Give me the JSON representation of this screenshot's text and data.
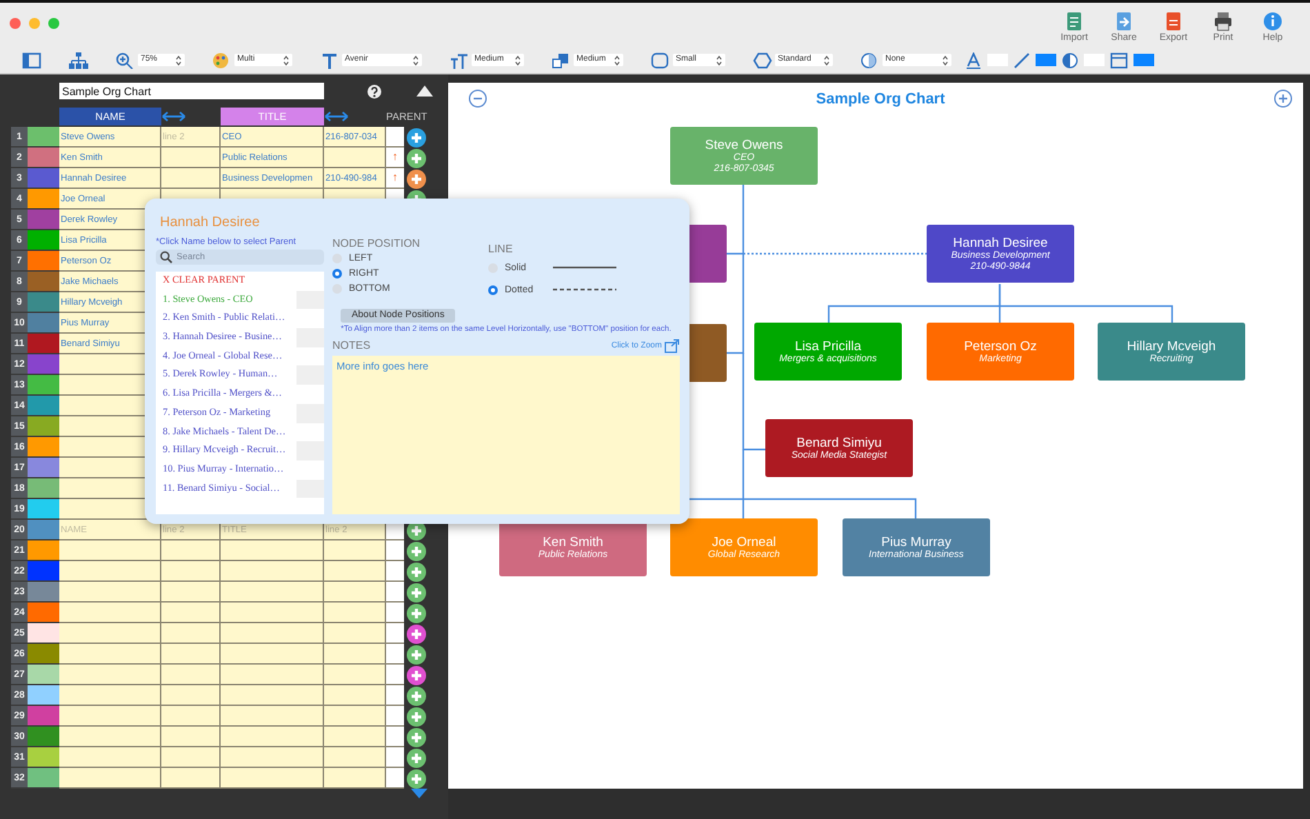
{
  "toolbar": {
    "actions": [
      {
        "label": "Import",
        "kind": "import"
      },
      {
        "label": "Share",
        "kind": "share"
      },
      {
        "label": "Export",
        "kind": "export"
      },
      {
        "label": "Print",
        "kind": "print"
      },
      {
        "label": "Help",
        "kind": "help"
      }
    ]
  },
  "format_bar": [
    {
      "kind": "zoom",
      "value": "75%"
    },
    {
      "kind": "palette",
      "value": "Multi"
    },
    {
      "kind": "font",
      "value": "Avenir"
    },
    {
      "kind": "text-size",
      "value": "Medium"
    },
    {
      "kind": "shadow",
      "value": "Medium"
    },
    {
      "kind": "corner",
      "value": "Small"
    },
    {
      "kind": "shape",
      "value": "Standard"
    },
    {
      "kind": "opacity",
      "value": "None"
    }
  ],
  "sheet": {
    "chart_name": "Sample Org Chart",
    "columns": [
      {
        "kind": "name",
        "label": "NAME"
      },
      {
        "kind": "resize"
      },
      {
        "kind": "title",
        "label": "TITLE"
      },
      {
        "kind": "resize"
      },
      {
        "kind": "parent",
        "label": "PARENT"
      }
    ],
    "rows": [
      {
        "number": "1",
        "color": "#6cbf6c",
        "name": "Steve Owens",
        "line2_placeholder": "line 2",
        "title": "CEO",
        "title_line2": "216-807-034",
        "add_button": {
          "color": "#2aa0e0"
        }
      },
      {
        "number": "2",
        "color": "#d07080",
        "name": "Ken Smith",
        "title": "Public Relations",
        "parent_mark": "↑",
        "add_button": {
          "color": "#6cc070"
        }
      },
      {
        "number": "3",
        "color": "#5a5ad0",
        "name": "Hannah Desiree",
        "title": "Business Developmen",
        "title_line2": "210-490-984",
        "parent_mark": "↑",
        "add_button": {
          "color": "#f0904c"
        }
      },
      {
        "number": "4",
        "color": "#ff9900",
        "name": "Joe Orneal",
        "add_button": {
          "color": "#6cc070"
        }
      },
      {
        "number": "5",
        "color": "#a040a0",
        "name": "Derek Rowley"
      },
      {
        "number": "6",
        "color": "#00b000",
        "name": "Lisa Pricilla"
      },
      {
        "number": "7",
        "color": "#ff7000",
        "name": "Peterson Oz"
      },
      {
        "number": "8",
        "color": "#9a6024",
        "name": "Jake Michaels"
      },
      {
        "number": "9",
        "color": "#3a8a8a",
        "name": "Hillary Mcveigh"
      },
      {
        "number": "10",
        "color": "#5080a0",
        "name": "Pius Murray"
      },
      {
        "number": "11",
        "color": "#b01820",
        "name": "Benard Simiyu"
      },
      {
        "number": "12",
        "color": "#8844cc"
      },
      {
        "number": "13",
        "color": "#44bb44"
      },
      {
        "number": "14",
        "color": "#2299aa"
      },
      {
        "number": "15",
        "color": "#88aa22"
      },
      {
        "number": "16",
        "color": "#ff9900"
      },
      {
        "number": "17",
        "color": "#8888dd"
      },
      {
        "number": "18",
        "color": "#77bb77"
      },
      {
        "number": "19",
        "color": "#22ccee"
      },
      {
        "number": "20",
        "color": "#5090c0",
        "name_placeholder": "NAME",
        "line2_placeholder": "line 2",
        "title_placeholder": "TITLE",
        "title_line2_placeholder": "line 2",
        "add_button": {
          "color": "#6cc070"
        }
      },
      {
        "number": "21",
        "color": "#ff9900",
        "add_button": {
          "color": "#6cc070"
        }
      },
      {
        "number": "22",
        "color": "#0033ff",
        "add_button": {
          "color": "#6cc070"
        }
      },
      {
        "number": "23",
        "color": "#778899",
        "add_button": {
          "color": "#6cc070"
        }
      },
      {
        "number": "24",
        "color": "#ff6a00",
        "add_button": {
          "color": "#6cc070"
        }
      },
      {
        "number": "25",
        "color": "#ffe4e4",
        "add_button": {
          "color": "#e050d0"
        }
      },
      {
        "number": "26",
        "color": "#8a8a00",
        "add_button": {
          "color": "#6cc070"
        }
      },
      {
        "number": "27",
        "color": "#a8d8a8",
        "add_button": {
          "color": "#e050d0"
        }
      },
      {
        "number": "28",
        "color": "#90d0ff",
        "add_button": {
          "color": "#6cc070"
        }
      },
      {
        "number": "29",
        "color": "#d040a0",
        "add_button": {
          "color": "#6cc070"
        }
      },
      {
        "number": "30",
        "color": "#309020",
        "add_button": {
          "color": "#6cc070"
        }
      },
      {
        "number": "31",
        "color": "#a8d040",
        "add_button": {
          "color": "#6cc070"
        }
      },
      {
        "number": "32",
        "color": "#70c080",
        "add_button": {
          "color": "#6cc070"
        }
      }
    ]
  },
  "node_editor": {
    "title": "Hannah Desiree",
    "parent_hint": "*Click Name below to select Parent",
    "search_placeholder": "Search",
    "parents": [
      {
        "label": "X CLEAR PARENT",
        "kind": "clear",
        "selected": false
      },
      {
        "label": "1. Steve Owens - CEO",
        "kind": "person",
        "selected": true
      },
      {
        "label": "2. Ken Smith - Public Relati…",
        "kind": "person",
        "selected": false
      },
      {
        "label": "3. Hannah Desiree - Busine…",
        "kind": "person",
        "selected": false
      },
      {
        "label": "4. Joe Orneal - Global Rese…",
        "kind": "person",
        "selected": false
      },
      {
        "label": "5. Derek Rowley - Human…",
        "kind": "person",
        "selected": false
      },
      {
        "label": "6. Lisa Pricilla - Mergers &…",
        "kind": "person",
        "selected": false
      },
      {
        "label": "7. Peterson Oz - Marketing",
        "kind": "person",
        "selected": false
      },
      {
        "label": "8. Jake Michaels - Talent De…",
        "kind": "person",
        "selected": false
      },
      {
        "label": "9. Hillary Mcveigh - Recruit…",
        "kind": "person",
        "selected": false
      },
      {
        "label": "10. Pius Murray - Internatio…",
        "kind": "person",
        "selected": false
      },
      {
        "label": "11. Benard Simiyu - Social…",
        "kind": "person",
        "selected": false
      }
    ],
    "position_label": "NODE POSITION",
    "positions": [
      {
        "label": "LEFT",
        "selected": false
      },
      {
        "label": "RIGHT",
        "selected": true
      },
      {
        "label": "BOTTOM",
        "selected": false
      }
    ],
    "line_label": "LINE",
    "line_styles": [
      {
        "label": "Solid",
        "kind": "solid",
        "selected": false
      },
      {
        "label": "Dotted",
        "kind": "dotted",
        "selected": true
      }
    ],
    "about_button": "About Node Positions",
    "align_note": "*To Align more than 2 items on the same Level Horizontally, use \"BOTTOM\" position for each.",
    "notes_label": "NOTES",
    "zoom_link": "Click to Zoom",
    "notes": "More info goes here"
  },
  "chart": {
    "title": "Sample Org Chart",
    "nodes": [
      {
        "name": "Steve Owens",
        "title": "CEO",
        "line2": "216-807-0345",
        "color": "#68b36a"
      },
      {
        "color": "#973c98",
        "connector": {
          "kind": "solid"
        }
      },
      {
        "color": "#8f5a24",
        "connector": {
          "kind": "solid"
        }
      },
      {
        "name": "Hannah Desiree",
        "title": "Business Development",
        "line2": "210-490-9844",
        "color": "#4f48c8",
        "connector": {
          "kind": "dotted"
        }
      },
      {
        "name": "Lisa Pricilla",
        "title": "Mergers & acquisitions",
        "color": "#00a800",
        "connector": {
          "kind": "solid"
        }
      },
      {
        "name": "Peterson Oz",
        "title": "Marketing",
        "color": "#ff6a00",
        "connector": {
          "kind": "solid"
        }
      },
      {
        "name": "Hillary Mcveigh",
        "title": "Recruiting",
        "color": "#3a8a8a",
        "connector": {
          "kind": "solid"
        }
      },
      {
        "name": "Benard Simiyu",
        "title": "Social Media Stategist",
        "color": "#ad1a22",
        "connector": {
          "kind": "solid"
        }
      },
      {
        "name": "Ken Smith",
        "title": "Public Relations",
        "color": "#cf6a80",
        "connector": {
          "kind": "solid"
        }
      },
      {
        "name": "Joe Orneal",
        "title": "Global Research",
        "color": "#ff8c00",
        "connector": {
          "kind": "solid"
        }
      },
      {
        "name": "Pius Murray",
        "title": "International Business",
        "color": "#5282a3",
        "connector": {
          "kind": "solid"
        }
      }
    ]
  }
}
